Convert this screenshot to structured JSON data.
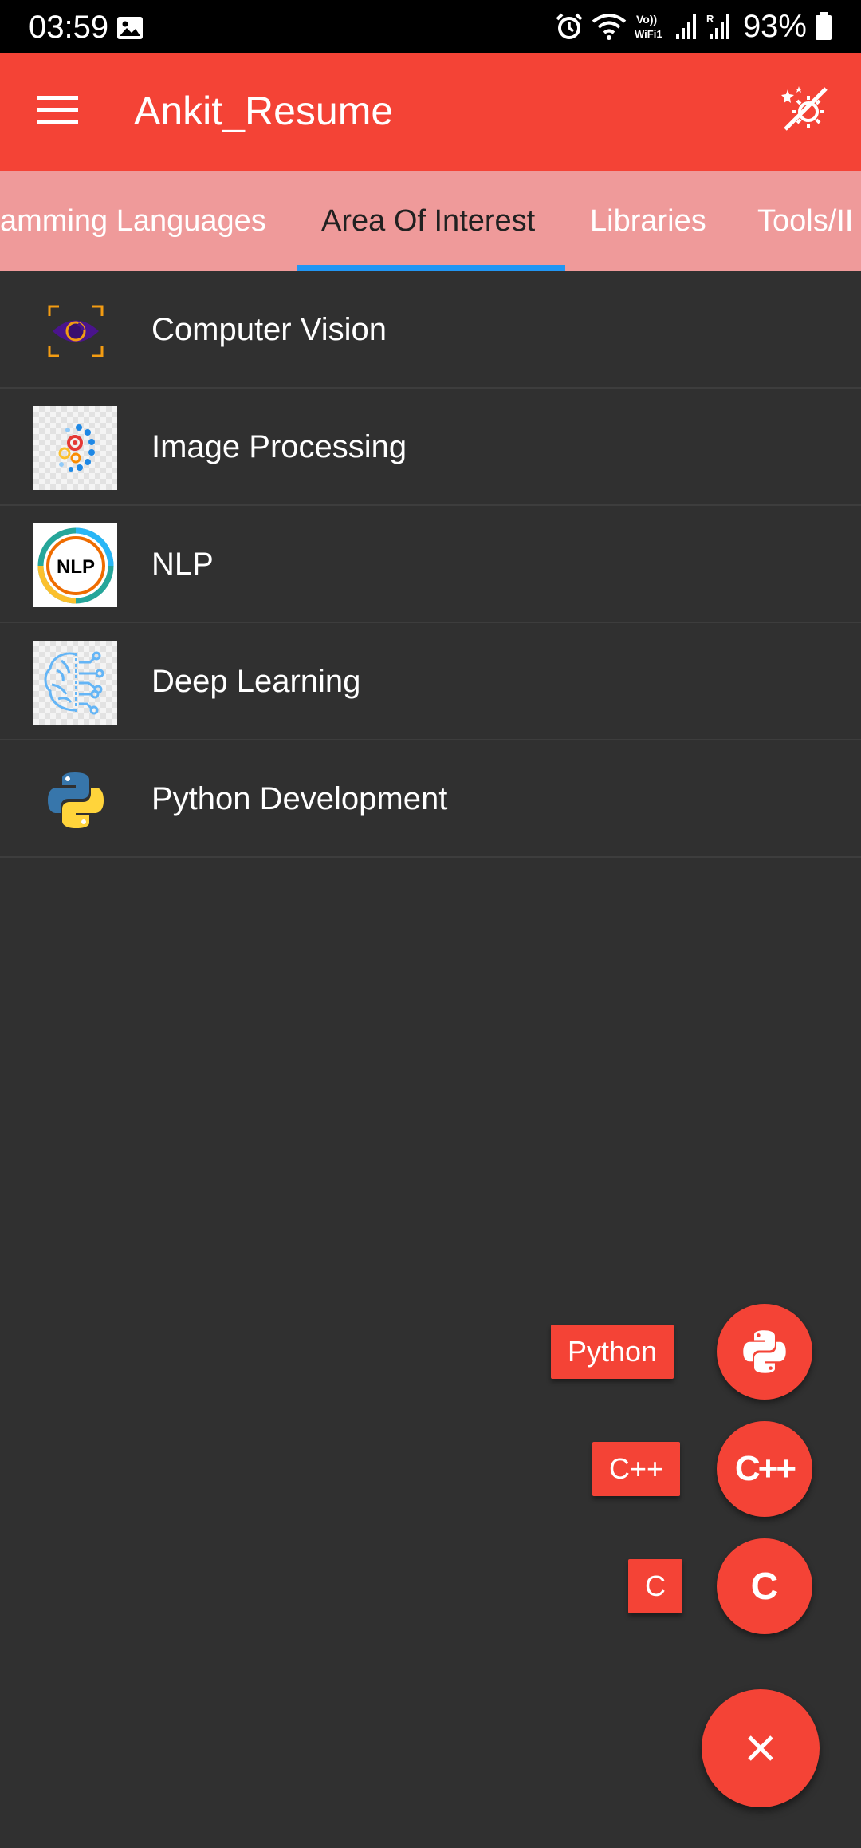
{
  "status_bar": {
    "time": "03:59",
    "battery": "93%",
    "icons": [
      "gallery-icon",
      "alarm-icon",
      "wifi-icon",
      "volte-wifi-icon",
      "signal-icon",
      "signal-roaming-icon",
      "battery-icon"
    ],
    "volte_text": "Vo))",
    "wifi_text": "WiFi1",
    "roaming_text": "R"
  },
  "app_bar": {
    "title": "Ankit_Resume",
    "menu_icon": "menu-icon",
    "action_icon": "theme-toggle-icon",
    "color": "#f44336"
  },
  "tabs": {
    "items": [
      {
        "label": "amming Languages",
        "active": false
      },
      {
        "label": "Area Of Interest",
        "active": true
      },
      {
        "label": "Libraries",
        "active": false
      },
      {
        "label": "Tools/II",
        "active": false
      }
    ],
    "background": "#ef9a9a",
    "indicator_color": "#2196f3"
  },
  "list": {
    "items": [
      {
        "label": "Computer Vision",
        "icon": "computer-vision-icon"
      },
      {
        "label": "Image Processing",
        "icon": "image-processing-icon"
      },
      {
        "label": "NLP",
        "icon": "nlp-icon",
        "icon_text": "NLP"
      },
      {
        "label": "Deep Learning",
        "icon": "deep-learning-brain-icon"
      },
      {
        "label": "Python Development",
        "icon": "python-logo-icon"
      }
    ]
  },
  "speed_dial": {
    "actions": [
      {
        "label": "Python",
        "icon": "python-icon"
      },
      {
        "label": "C++",
        "icon": "cpp-icon",
        "icon_text": "C++"
      },
      {
        "label": "C",
        "icon": "c-icon",
        "icon_text": "C"
      }
    ],
    "main_icon": "close-icon",
    "color": "#f44336"
  }
}
